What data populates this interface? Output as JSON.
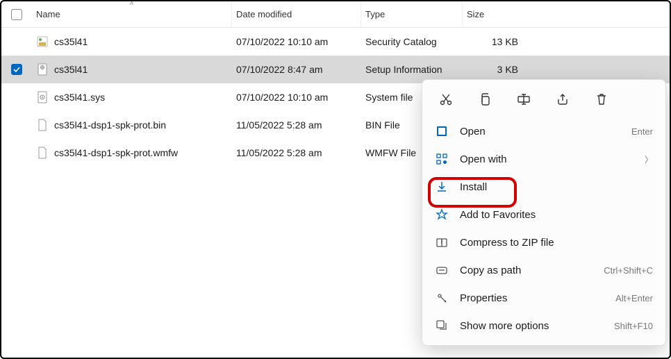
{
  "columns": {
    "name": "Name",
    "date": "Date modified",
    "type": "Type",
    "size": "Size"
  },
  "files": [
    {
      "name": "cs35l41",
      "date": "07/10/2022 10:10 am",
      "type": "Security Catalog",
      "size": "13 KB",
      "selected": false
    },
    {
      "name": "cs35l41",
      "date": "07/10/2022 8:47 am",
      "type": "Setup Information",
      "size": "3 KB",
      "selected": true
    },
    {
      "name": "cs35l41.sys",
      "date": "07/10/2022 10:10 am",
      "type": "System file",
      "size": "",
      "selected": false
    },
    {
      "name": "cs35l41-dsp1-spk-prot.bin",
      "date": "11/05/2022 5:28 am",
      "type": "BIN File",
      "size": "",
      "selected": false
    },
    {
      "name": "cs35l41-dsp1-spk-prot.wmfw",
      "date": "11/05/2022 5:28 am",
      "type": "WMFW File",
      "size": "",
      "selected": false
    }
  ],
  "ctx": {
    "open": "Open",
    "open_sc": "Enter",
    "openwith": "Open with",
    "install": "Install",
    "fav": "Add to Favorites",
    "zip": "Compress to ZIP file",
    "copypath": "Copy as path",
    "copypath_sc": "Ctrl+Shift+C",
    "props": "Properties",
    "props_sc": "Alt+Enter",
    "more": "Show more options",
    "more_sc": "Shift+F10"
  }
}
